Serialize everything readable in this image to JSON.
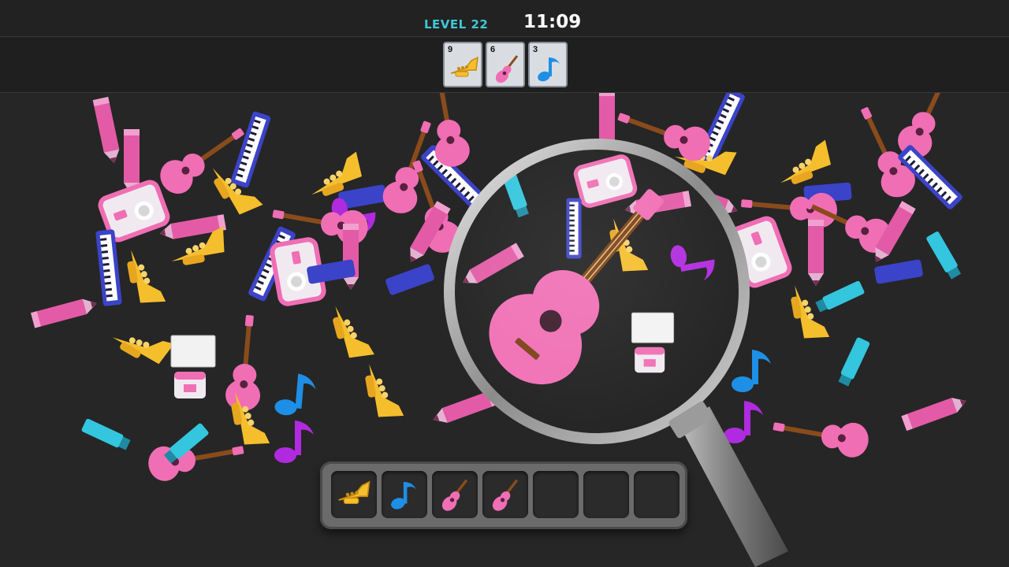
{
  "hud": {
    "level_label": "LEVEL 22",
    "timer": "11:09"
  },
  "targets": [
    {
      "icon": "trumpet-icon",
      "count": "9"
    },
    {
      "icon": "ukulele-icon",
      "count": "6"
    },
    {
      "icon": "music-note-icon",
      "count": "3"
    }
  ],
  "tray": {
    "slots": [
      "trumpet-icon",
      "music-note-icon",
      "ukulele-icon",
      "ukulele-icon",
      "",
      "",
      ""
    ]
  },
  "colors": {
    "pink": "#f06eb4",
    "blue": "#3b43c9",
    "cyan": "#33c6de",
    "yellow": "#f5be2c",
    "magenta": "#b02adf",
    "white": "#eeeeee",
    "accent": "#41c6d8"
  }
}
